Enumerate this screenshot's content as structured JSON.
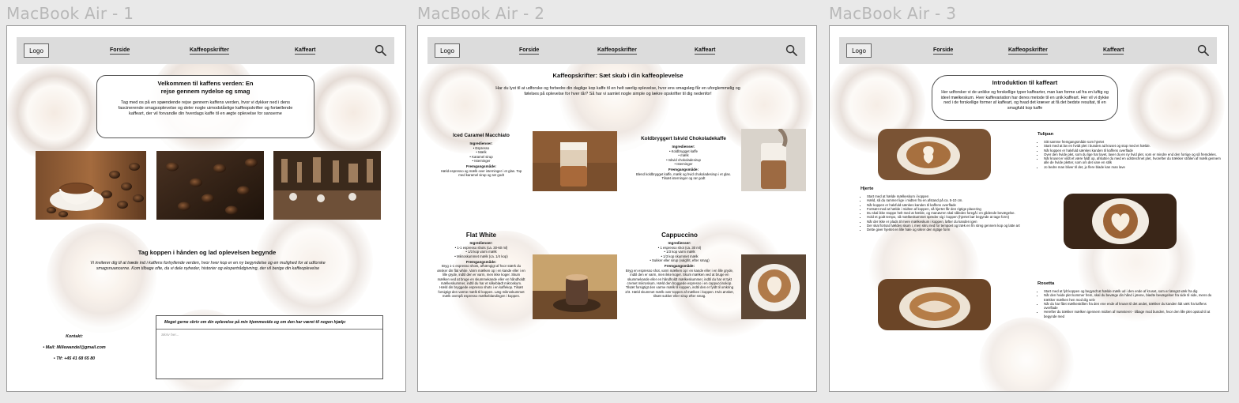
{
  "frames": [
    {
      "title": "MacBook Air - 1",
      "nav": {
        "logo": "Logo",
        "links": [
          "Forside",
          "Kaffeopskrifter",
          "Kaffeart"
        ]
      },
      "welcome": {
        "heading_line1": "Velkommen til kaffens verden: En",
        "heading_line2": "rejse gennem nydelse og smag",
        "body": "Tag med os på en spændende rejse gennem kaffens verden, hvor vi dykker ned i dens fascinerende smagsoplevelse og deler nogle uimodståelige kaffeopskrifter og fortællende kaffeart, der vil forvandle din hverdags kaffe til en ægte oplevelse for sanserne"
      },
      "section": {
        "heading": "Tag koppen i hånden og lad oplevelsen begynde",
        "body": "Vi inviterer dig til at træde ind i kaffens fortryllende verden, hvor hver kop er en ny begyndelse og en mulighed for at udforske smagsnuancerne. Kom tilbage ofte, da vi dele nyheder, historier og ekspertrådgivning, der vil berige din kaffeoplevelse"
      },
      "contact": {
        "title": "Kontakt:",
        "mail": "Mail: Millewandel@gmail.com",
        "phone": "Tlf: +45 41 68 65 80"
      },
      "form": {
        "label": "Meget gerne skriv om din oplevelse på min hjemmeside og om den har været til nogen hjælp:",
        "placeholder": "Skriv her..."
      }
    },
    {
      "title": "MacBook Air - 2",
      "nav": {
        "logo": "Logo",
        "links": [
          "Forside",
          "Kaffeopskrifter",
          "Kaffeart"
        ]
      },
      "heading": "Kaffeopskrifter: Sæt skub i din kaffeoplevelse",
      "intro": "Har du lyst til at udforske og forbedre din daglige kop kaffe til en helt særlig oplevelse, hvor ens smagsløg får en uforglemmelig og følelses på oplevelse for hver tår? Så har vi samlet nogle simple og lækre opskrifter til dig nedenfor!",
      "recipes": [
        {
          "title": "Iced Caramel Macchiato",
          "ing_label": "Ingredienser:",
          "ingredients": [
            "Espresso",
            "Mælk",
            "Karamel sirup",
            "Isterninger"
          ],
          "method_label": "Fremgangsmåde:",
          "method": "Hæld espresso og mælk over isterninger i et glas. Top med karamel sirup og rør godt"
        },
        {
          "title": "Koldbryggert Iskvid Chokoladekaffe",
          "ing_label": "Ingredienser:",
          "ingredients": [
            "Koldbrygget kaffe",
            "mælk",
            "Iskvid chokoladesirup",
            "Isterninger"
          ],
          "method_label": "Fremgangsmåde:",
          "method": "Blend koldbrygget kaffe, mælk og hvid chokoladesirup i et glas. Tilsæt isterninger og rør godt"
        },
        {
          "title": "Flat White",
          "ing_label": "Ingredienser:",
          "ingredients": [
            "1-1 espresso shots (ca. 30-60 ml)",
            "1/3 kop varm mælk",
            "Mikroskummet mælk (ca. 1/4 kop)"
          ],
          "method_label": "Fremgangsmåde:",
          "method": "Bryg 1-1 espresso shots, afhængigt af hvor stærk du ønsker din flat white. Varm mælken op i en kande eller i en lille gryde, indtil den er varm, men ikke koger. Skum mælken ved at bruge en skummekande eller en håndholdt mælkeskummer, indtil du har et silkeblødt mikroskum. Hæld din bryggede espresso shots i en kaffekop. Tilsæt forsigtigt den varme mælk til koppen. Læg mikroskummet mælk ovenpå espresso mælkeblandingen i koppen."
        },
        {
          "title": "Cappuccino",
          "ing_label": "Ingredienser:",
          "ingredients": [
            "1 espresso shot (ca. 30 ml)",
            "1/3 kop varm mælk",
            "1/3 kop skummet mælk",
            "Sukker eller sirup (valgfrit, efter smag)"
          ],
          "method_label": "Fremgangsmåde:",
          "method": "Bryg en espresso shot, varm mælken op i en kande eller i en lille gryde, indtil den er varm, men ikke koger. Skum mælken ved at bruge en skummekande eller en håndholdt mælkeskummer, indtil du har et tykt cremet mikroskum. Hæld den bryggede espresso i en cappuccinokop. Tilsæt forsigtigt den varme mælk til koppen, indtil den er fyldt til omkring 2/3. Hæld skummet mælk over toppen af mælken i koppen. Hvis ønsket, tilsæt sukker eller sirup efter smag."
        }
      ]
    },
    {
      "title": "MacBook Air - 3",
      "nav": {
        "logo": "Logo",
        "links": [
          "Forside",
          "Kaffeopskrifter",
          "Kaffeart"
        ]
      },
      "heading": "Introduktion til kaffeart",
      "intro": "Her udforsker vi de unikke og forskellige typer kaffearter, man kan forme ud fra en luftig og ideel mælkeskum. Hver kaffevariation har deres metode til en unik kaffeart. Her vil vi dykke ned i de forskellige former af kaffeart, og hvad det kræver at få det bedste resultat, til en smagfuld kop kaffe",
      "arts": [
        {
          "title": "Tulipan",
          "steps": [
            "Sitt samme fremgangsmåde som hjertet",
            "Start med at lav en hvidt plet i bunden ad kruset og stop med et hælde.",
            "Når koppen er halvfuld sænkes kanden til kaffens overflade",
            "Over den hvide plet, som du lige har lavet, laver du en ny hvid plet, som er mindre end den forrige og så fremdeles.",
            "Når kruset er vildt et være fyldt op, afslutter du med en udstrechnet plet, hvorefter du trækker strålen af mælk gennem alle de hvide pletter, som om det vare en stilk",
            "Jo bedre man bliver til det, jo flere blade kan man lave"
          ]
        },
        {
          "title": "Hjerte",
          "steps": [
            "Start med at hælde mælkeskum i koppen",
            "Hæld, så du rammer lige i midten fra en afstand på ca. 5-10 cm.",
            "Når koppen er halvfuld sænkes kanden til kaffens overflade",
            "Fortsæt med at hælde i midten af koppen, så hjertet får den rigtige placering",
            "Du skal ikke stoppe helt med at hælde, og manøvren skal således foregå i en glidende bevægelse.",
            "Hold et godt tempo, så mælkeskummet spreder sig i koppen (hjertet bør begynde at tage form)",
            "Når der ikke er plads til mere mælkeskum i koppen, løfter du kanden igen",
            "Der skal fortsat hældes skum i, men skru ned for tempoet og træk en fin streg gennem kop og latte art",
            "Dette giver hjertet en lille hale og sikrer den rigtige form"
          ]
        },
        {
          "title": "Rosetta",
          "steps": [
            "Start med at fylt koppen og begyndt at hælde mælk ud i den ende af kruset, som er længst væk fra dig",
            "Når den hvide plet kommer frem, skal du bevæge din hånd i jævne, blødte bevægelser fra side til side, mens du trækker mælken hen mod dig selv",
            "Når du har fået mælkestrålen fra den ene ende af kruset til det andet, trækker du kanden lidt væk fra kaffens overflade",
            "Herefter du trækker mælken igennem midten af mønsteret - tilbage mod bunden, hvor den lille plet opstod til at begynde med"
          ]
        }
      ]
    }
  ]
}
